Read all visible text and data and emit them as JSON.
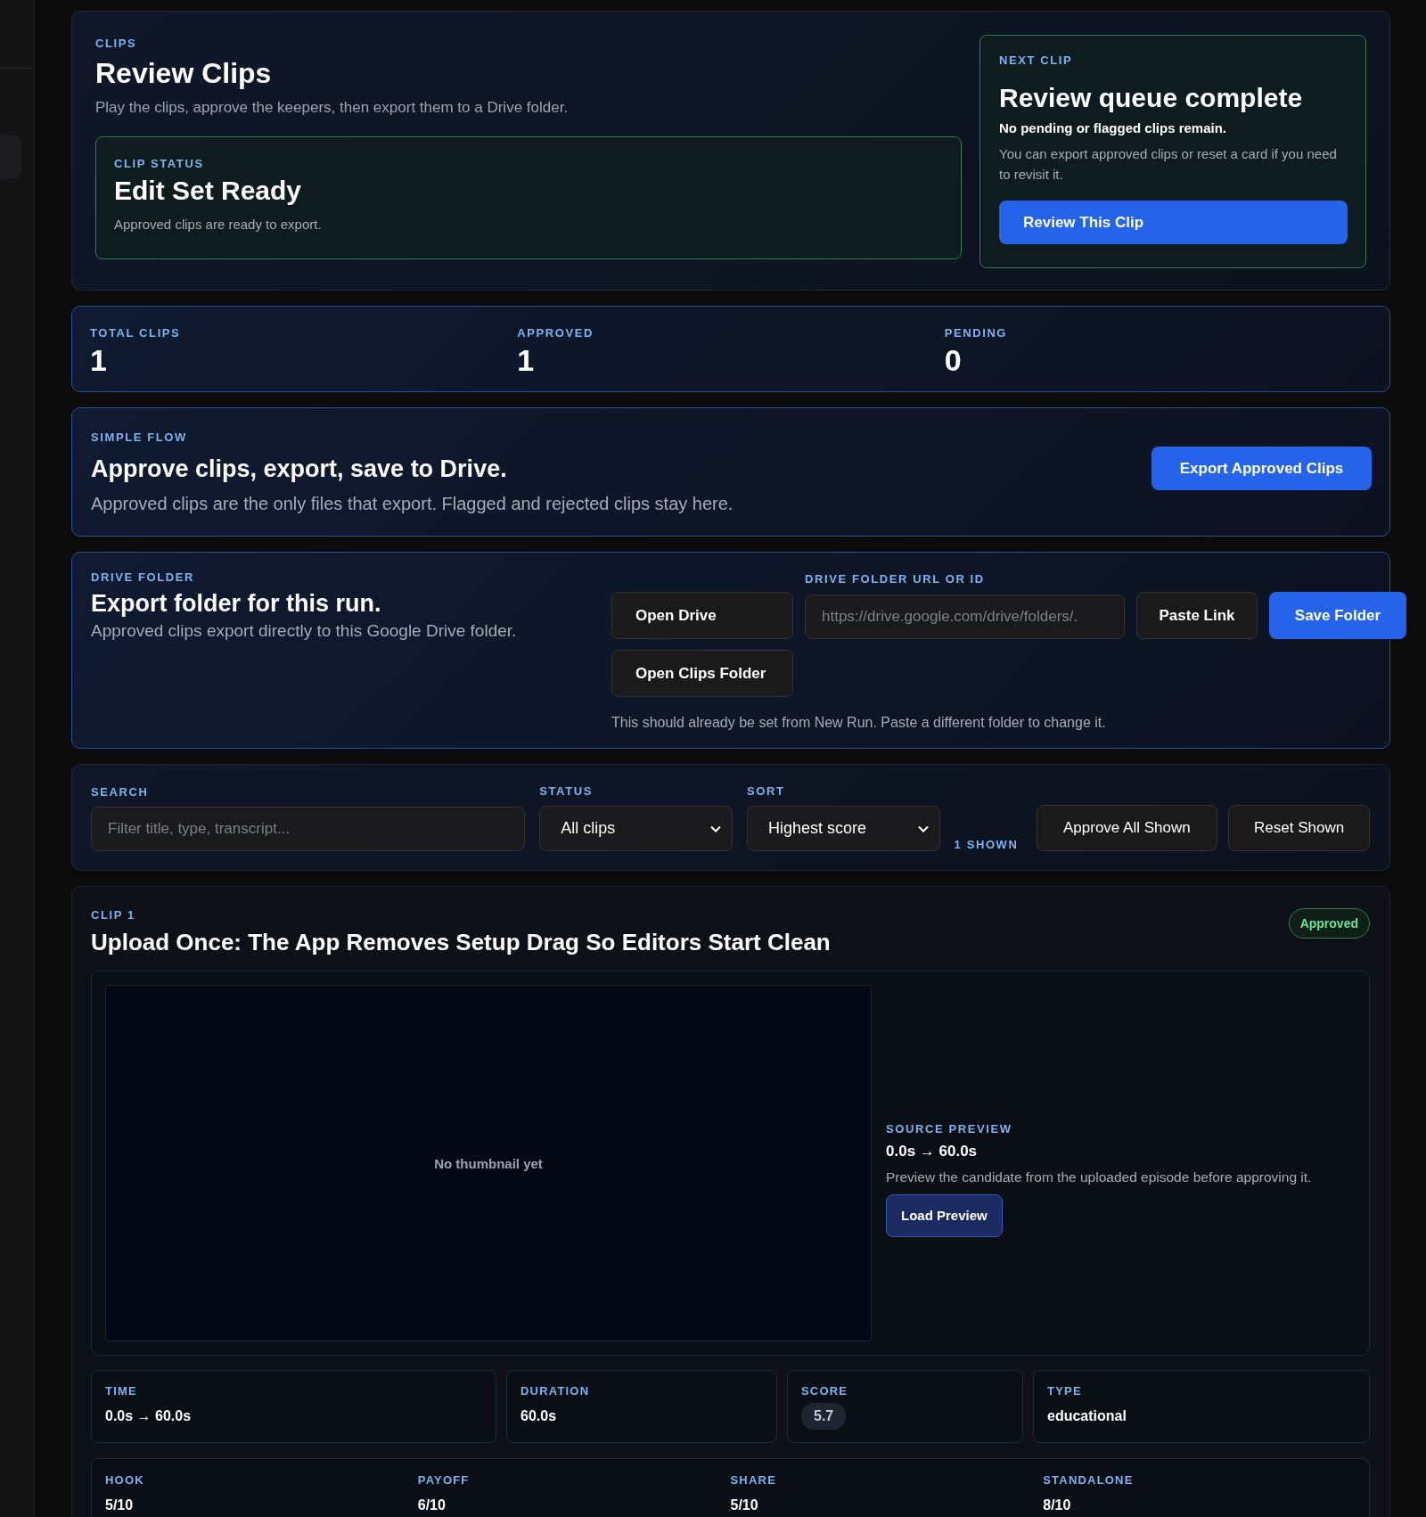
{
  "hero": {
    "label": "CLIPS",
    "title": "Review Clips",
    "subtitle": "Play the clips, approve the keepers, then export them to a Drive folder.",
    "status": {
      "label": "CLIP STATUS",
      "title": "Edit Set Ready",
      "text": "Approved clips are ready to export."
    },
    "next": {
      "label": "NEXT CLIP",
      "title": "Review queue complete",
      "subtitle": "No pending or flagged clips remain.",
      "text": "You can export approved clips or reset a card if you need to revisit it.",
      "button": "Review This Clip"
    }
  },
  "stats": [
    {
      "label": "TOTAL CLIPS",
      "value": "1"
    },
    {
      "label": "APPROVED",
      "value": "1"
    },
    {
      "label": "PENDING",
      "value": "0"
    }
  ],
  "flow": {
    "label": "SIMPLE FLOW",
    "title": "Approve clips, export, save to Drive.",
    "text": "Approved clips are the only files that export. Flagged and rejected clips stay here.",
    "button": "Export Approved Clips"
  },
  "drive": {
    "label": "DRIVE FOLDER",
    "title": "Export folder for this run.",
    "text": "Approved clips export directly to this Google Drive folder.",
    "open_button": "Open Drive",
    "field_label": "DRIVE FOLDER URL OR ID",
    "field": {
      "placeholder": "https://drive.google.com/drive/folders/."
    },
    "actions": [
      {
        "label": "Paste Link",
        "kind": "secondary"
      },
      {
        "label": "Save Folder",
        "kind": "primary"
      }
    ],
    "clips_button": "Open Clips Folder",
    "hint": "This should already be set from New Run. Paste a different folder to change it."
  },
  "filters": {
    "search": {
      "label": "SEARCH",
      "placeholder": "Filter title, type, transcript..."
    },
    "status": {
      "label": "STATUS",
      "value": "All clips"
    },
    "sort": {
      "label": "SORT",
      "value": "Highest score"
    },
    "count": "1 SHOWN",
    "actions": [
      "Approve All Shown",
      "Reset Shown"
    ]
  },
  "clip": {
    "label": "CLIP 1",
    "title": "Upload Once: The App Removes Setup Drag So Editors Start Clean",
    "badge": {
      "text": "Approved",
      "approved": true
    },
    "thumbnail_text": "No thumbnail yet",
    "preview": {
      "label": "SOURCE PREVIEW",
      "range": "0.0s → 60.0s",
      "text": "Preview the candidate from the uploaded episode before approving it.",
      "button": "Load Preview"
    },
    "facts": [
      {
        "label": "TIME",
        "value": "0.0s → 60.0s",
        "kind": "text"
      },
      {
        "label": "DURATION",
        "value": "60.0s",
        "kind": "text"
      },
      {
        "label": "SCORE",
        "value": "5.7",
        "kind": "pill"
      },
      {
        "label": "TYPE",
        "value": "educational",
        "kind": "text"
      }
    ],
    "scores": [
      {
        "label": "HOOK",
        "value": "5/10"
      },
      {
        "label": "PAYOFF",
        "value": "6/10"
      },
      {
        "label": "SHARE",
        "value": "5/10"
      },
      {
        "label": "STANDALONE",
        "value": "8/10"
      }
    ]
  }
}
